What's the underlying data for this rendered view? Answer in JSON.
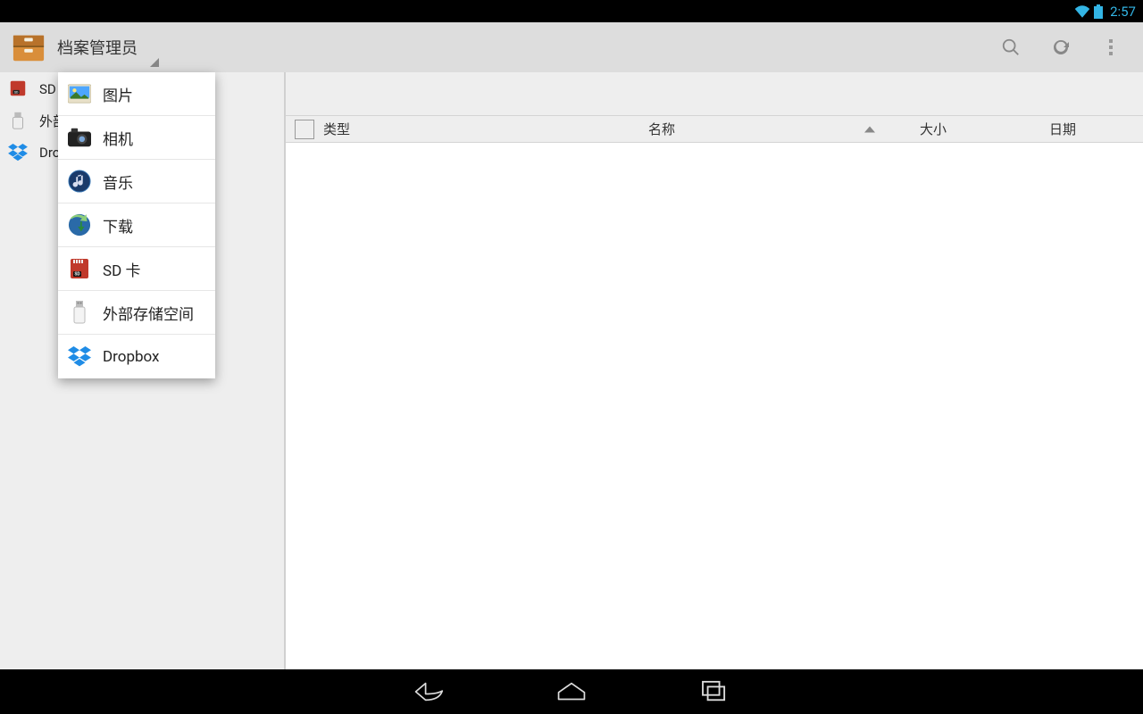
{
  "status": {
    "time": "2:57"
  },
  "action_bar": {
    "title": "档案管理员"
  },
  "sidebar": {
    "items": [
      {
        "label": "SD 卡"
      },
      {
        "label": "外部存储空间"
      },
      {
        "label": "Dropbox"
      }
    ]
  },
  "columns": {
    "type": "类型",
    "name": "名称",
    "size": "大小",
    "date": "日期"
  },
  "dropdown": {
    "items": [
      {
        "label": "图片"
      },
      {
        "label": "相机"
      },
      {
        "label": "音乐"
      },
      {
        "label": "下载"
      },
      {
        "label": "SD 卡"
      },
      {
        "label": "外部存储空间"
      },
      {
        "label": "Dropbox"
      }
    ]
  }
}
